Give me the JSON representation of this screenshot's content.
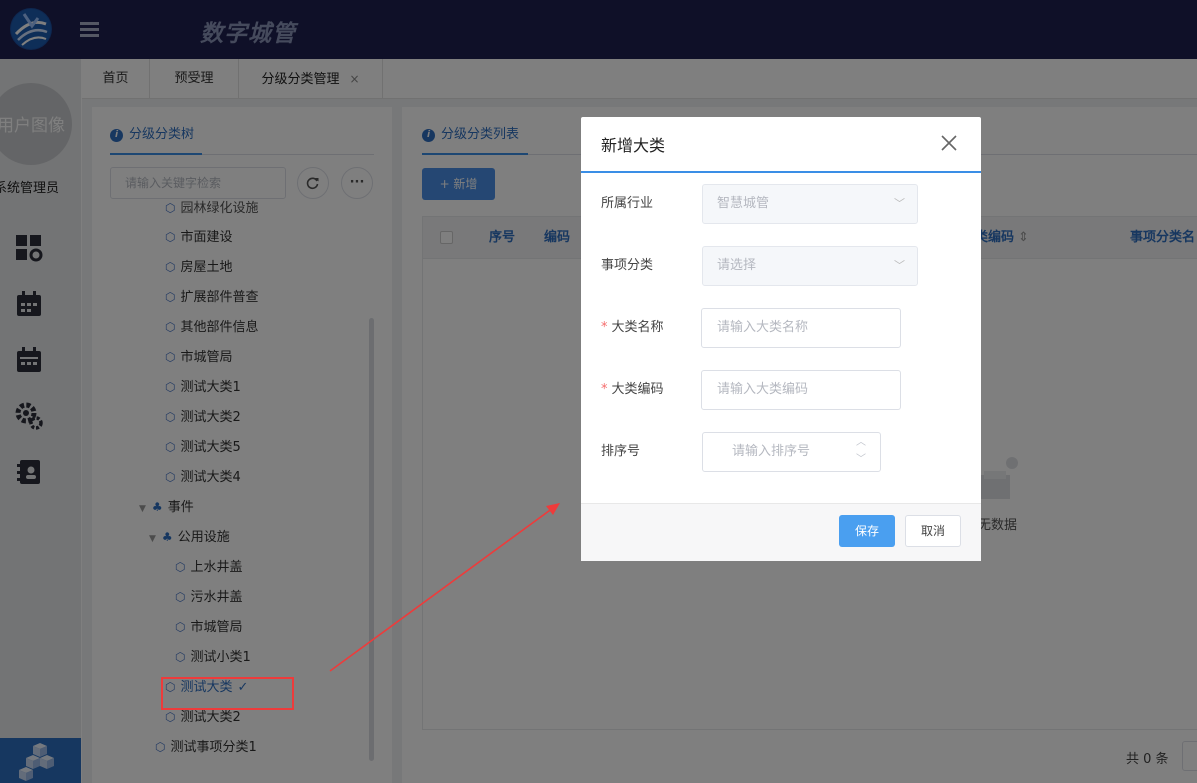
{
  "app": {
    "title": "数字城管"
  },
  "sidebar": {
    "avatar_text": "用户图像",
    "role": "系统管理员"
  },
  "tabs": [
    {
      "label": "首页"
    },
    {
      "label": "预受理"
    },
    {
      "label": "分级分类管理"
    }
  ],
  "tab_close": "×",
  "tree": {
    "title": "分级分类树",
    "search_placeholder": "请输入关键字检索",
    "more_label": "···",
    "nodes": [
      {
        "label": "园林绿化设施"
      },
      {
        "label": "市面建设"
      },
      {
        "label": "房屋土地"
      },
      {
        "label": "扩展部件普查"
      },
      {
        "label": "其他部件信息"
      },
      {
        "label": "市城管局"
      },
      {
        "label": "测试大类1"
      },
      {
        "label": "测试大类2"
      },
      {
        "label": "测试大类5"
      },
      {
        "label": "测试大类4"
      },
      {
        "label": "事件"
      },
      {
        "label": "公用设施"
      },
      {
        "label": "上水井盖"
      },
      {
        "label": "污水井盖"
      },
      {
        "label": "市城管局"
      },
      {
        "label": "测试小类1"
      },
      {
        "label": "测试大类",
        "check": "✓"
      },
      {
        "label": "测试大类2"
      },
      {
        "label": "测试事项分类1"
      }
    ]
  },
  "list": {
    "title": "分级分类列表",
    "add_label": "+ 新增",
    "columns": [
      "序号",
      "编码",
      "大类编码",
      "事项分类名"
    ],
    "sort_icon": "⇕",
    "empty_text": "无数据",
    "total_text": "共 0 条"
  },
  "dialog": {
    "title": "新增大类",
    "fields": {
      "industry": {
        "label": "所属行业",
        "value": "智慧城管"
      },
      "category": {
        "label": "事项分类",
        "placeholder": "请选择"
      },
      "name": {
        "label": "大类名称",
        "required_mark": "*",
        "placeholder": "请输入大类名称"
      },
      "code": {
        "label": "大类编码",
        "required_mark": "*",
        "placeholder": "请输入大类编码"
      },
      "sort": {
        "label": "排序号",
        "placeholder": "请输入排序号"
      }
    },
    "save_label": "保存",
    "cancel_label": "取消"
  },
  "colors": {
    "topbar": "#1f2051",
    "accent": "#3a8ee6",
    "highlight": "#ee3b3b",
    "arrow": "#ee3b3b"
  }
}
